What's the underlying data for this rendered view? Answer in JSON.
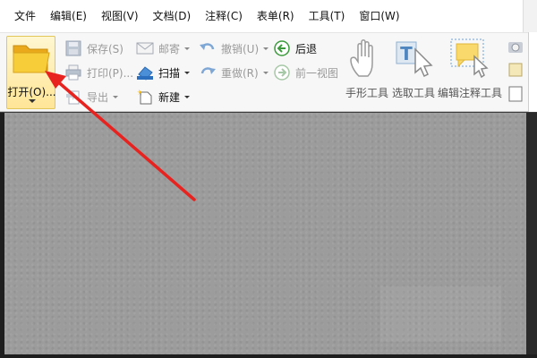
{
  "menu": {
    "items": [
      "文件",
      "编辑(E)",
      "视图(V)",
      "文档(D)",
      "注释(C)",
      "表单(R)",
      "工具(T)",
      "窗口(W)"
    ]
  },
  "toolbar": {
    "open_label": "打开(O)...",
    "save_label": "保存(S)",
    "mail_label": "邮寄",
    "undo_label": "撤销(U)",
    "back_label": "后退",
    "print_label": "打印(P)...",
    "scan_label": "扫描",
    "redo_label": "重做(R)",
    "prev_view_label": "前一视图",
    "export_label": "导出",
    "new_label": "新建",
    "hand_tool_label": "手形工具",
    "select_tool_label": "选取工具",
    "edit_annot_tool_label": "编辑注释工具"
  },
  "colors": {
    "annotation_arrow": "#e8231f",
    "open_folder": "#f5c52c",
    "back_arrow": "#3b9a3b"
  }
}
